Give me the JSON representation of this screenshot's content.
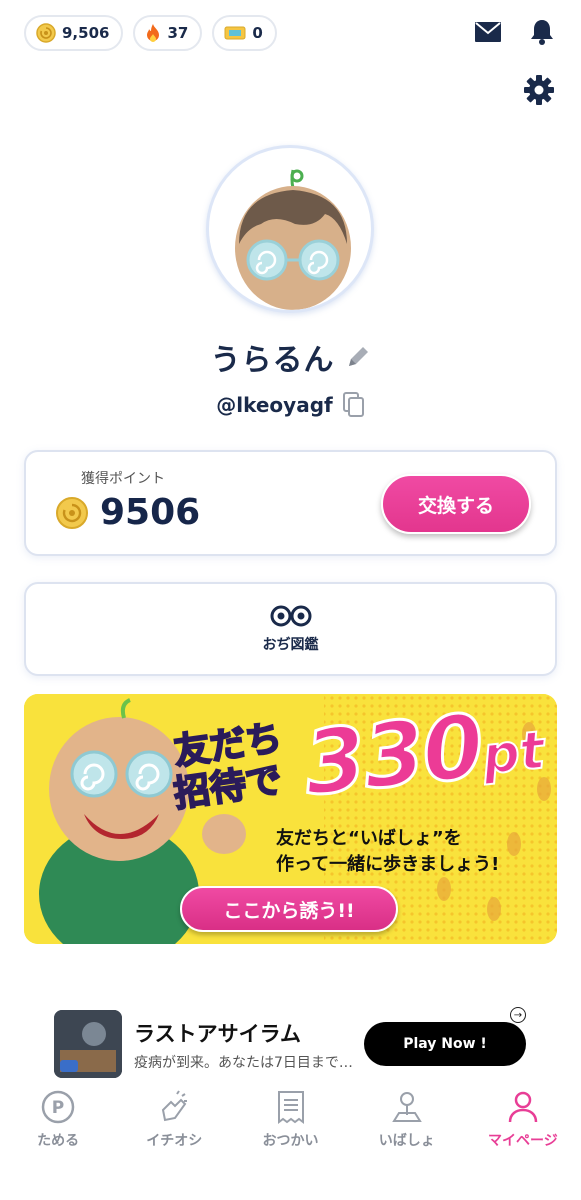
{
  "status": {
    "coins": "9,506",
    "streak": "37",
    "tickets": "0"
  },
  "profile": {
    "name": "うらるん",
    "handle": "@lkeoyagf"
  },
  "points": {
    "label": "獲得ポイント",
    "value": "9506",
    "exchange_label": "交換する"
  },
  "zukan": {
    "label": "おぢ図鑑"
  },
  "banner": {
    "line1": "友だち",
    "line2": "招待で",
    "amount": "330",
    "unit": "pt",
    "sub1": "友だちと“いばしょ”を",
    "sub2": "作って一緒に歩きましょう!",
    "cta": "ここから誘う!!"
  },
  "ad": {
    "title": "ラストアサイラム",
    "desc": "疫病が到来。あなたは7日目まで…",
    "button": "Play Now !"
  },
  "tabs": [
    {
      "label": "ためる",
      "icon": "points-p-icon"
    },
    {
      "label": "イチオシ",
      "icon": "snap-hand-icon"
    },
    {
      "label": "おつかい",
      "icon": "receipt-icon"
    },
    {
      "label": "いばしょ",
      "icon": "map-pin-icon"
    },
    {
      "label": "マイページ",
      "icon": "person-icon"
    }
  ],
  "colors": {
    "accent": "#e83e96",
    "navy": "#1a2a4a",
    "banner_yellow": "#f9e23c"
  }
}
